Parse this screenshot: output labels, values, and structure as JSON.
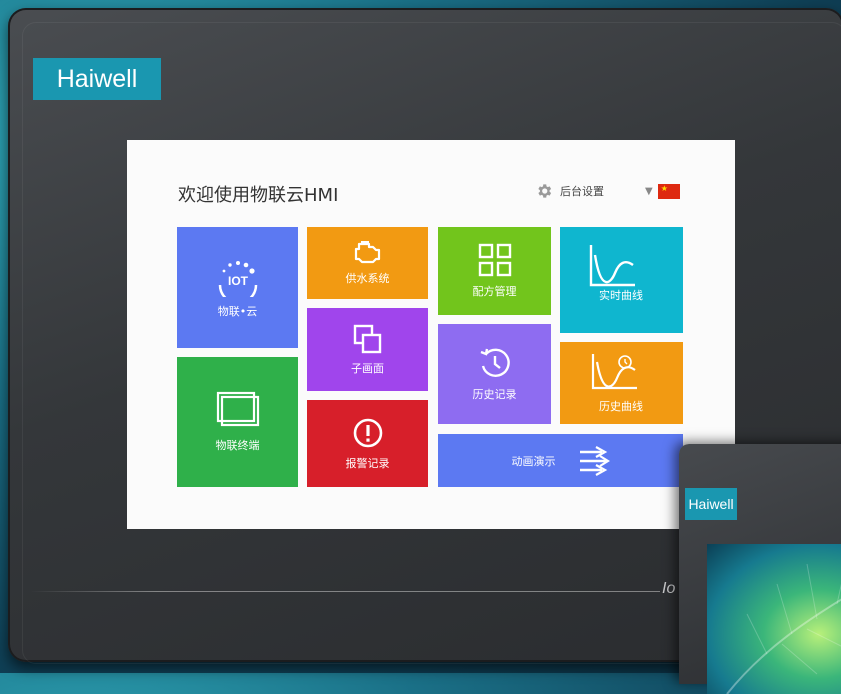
{
  "device": {
    "brand": "Haiwell",
    "bezel_text": "Io"
  },
  "hmi": {
    "title": "欢迎使用物联云HMI",
    "settings_label": "后台设置",
    "language": "zh-CN"
  },
  "tiles": {
    "iot_cloud": {
      "label": "物联•云",
      "icon_text": "IOT",
      "color": "#5c79f2"
    },
    "water_supply": {
      "label": "供水系统",
      "color": "#f29a12"
    },
    "recipe": {
      "label": "配方管理",
      "color": "#72c51c"
    },
    "realtime_curve": {
      "label": "实时曲线",
      "color": "#0fb6cf"
    },
    "sub_screen": {
      "label": "子画面",
      "color": "#a045ec"
    },
    "history_record": {
      "label": "历史记录",
      "color": "#8e6cf1"
    },
    "history_curve": {
      "label": "历史曲线",
      "color": "#f29a12"
    },
    "iot_terminal": {
      "label": "物联终端",
      "color": "#2fb04a"
    },
    "alarm_record": {
      "label": "报警记录",
      "color": "#d71f2a"
    },
    "animation_demo": {
      "label": "动画演示",
      "color": "#5c79f2"
    }
  },
  "device2": {
    "brand": "Haiwell"
  }
}
